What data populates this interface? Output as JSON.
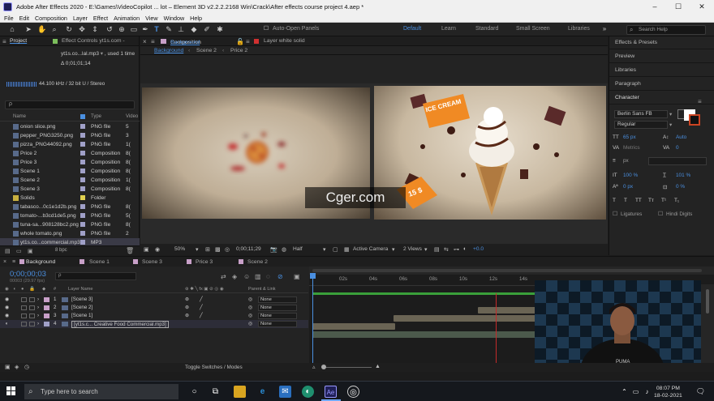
{
  "window": {
    "title": "Adobe After Effects 2020 - E:\\Games\\VideoCopilot ... lot – Element 3D v2.2.2.2168 Win\\Crack\\After effects course project 4.aep *",
    "controls": [
      "–",
      "☐",
      "✕"
    ]
  },
  "menu": [
    "File",
    "Edit",
    "Composition",
    "Layer",
    "Effect",
    "Animation",
    "View",
    "Window",
    "Help"
  ],
  "toolbar": {
    "auto_open_panels": "Auto-Open Panels",
    "workspaces": [
      "Default",
      "Learn",
      "Standard",
      "Small Screen",
      "Libraries"
    ],
    "active_workspace": "Default",
    "search_placeholder": "Search Help"
  },
  "project": {
    "tab_project": "Project",
    "tab_effect_controls": "Effect Controls yt1s.com -",
    "selected_file": "yt1s.co...lal.mp3",
    "used": ", used 1 time",
    "duration": "Δ 0;01;01;14",
    "audio_info": "44.100 kHz / 32 bit U / Stereo",
    "columns": [
      "Name",
      "Type",
      "Video"
    ],
    "items": [
      {
        "name": "onion slice.png",
        "type": "PNG file",
        "v": "5",
        "color": "#a0a0c8",
        "icon": "image-file-icon"
      },
      {
        "name": "pepper_PNG3250.png",
        "type": "PNG file",
        "v": "3",
        "color": "#a0a0c8",
        "icon": "image-file-icon"
      },
      {
        "name": "pizza_PNG44092.png",
        "type": "PNG file",
        "v": "1(",
        "color": "#a0a0c8",
        "icon": "image-file-icon"
      },
      {
        "name": "Price 2",
        "type": "Composition",
        "v": "8(",
        "color": "#a0a0c8",
        "icon": "composition-icon"
      },
      {
        "name": "Price 3",
        "type": "Composition",
        "v": "8(",
        "color": "#a0a0c8",
        "icon": "composition-icon"
      },
      {
        "name": "Scene 1",
        "type": "Composition",
        "v": "8(",
        "color": "#a0a0c8",
        "icon": "composition-icon"
      },
      {
        "name": "Scene 2",
        "type": "Composition",
        "v": "1(",
        "color": "#a0a0c8",
        "icon": "composition-icon"
      },
      {
        "name": "Scene 3",
        "type": "Composition",
        "v": "8(",
        "color": "#a0a0c8",
        "icon": "composition-icon"
      },
      {
        "name": "Solids",
        "type": "Folder",
        "v": "",
        "color": "#e0d050",
        "icon": "folder-icon"
      },
      {
        "name": "tabasco...0c1e1d2b.png",
        "type": "PNG file",
        "v": "8(",
        "color": "#a0a0c8",
        "icon": "image-file-icon"
      },
      {
        "name": "tomato-...b3cd1de5.png",
        "type": "PNG file",
        "v": "5(",
        "color": "#a0a0c8",
        "icon": "image-file-icon"
      },
      {
        "name": "tuna-sa...908128bc2.png",
        "type": "PNG file",
        "v": "8(",
        "color": "#a0a0c8",
        "icon": "image-file-icon"
      },
      {
        "name": "whole tomato.png",
        "type": "PNG file",
        "v": "2",
        "color": "#a0a0c8",
        "icon": "image-file-icon"
      },
      {
        "name": "yt1s.co...commercial.mp3",
        "type": "MP3",
        "v": "",
        "color": "#a0a0c8",
        "icon": "audio-file-icon",
        "selected": true
      }
    ],
    "bpc": "8 bpc"
  },
  "composition": {
    "tab": "Composition",
    "tab_comp_name": "Background",
    "layer_tab": "Layer  white solid",
    "breadcrumbs": [
      "Background",
      "Scene 2",
      "Price 2"
    ],
    "zoom": "50%",
    "timecode": "0;00;11;29",
    "resolution": "Half",
    "camera": "Active Camera",
    "views": "2 Views",
    "exposure": "+0.0",
    "ice_cream_label": "ICE CREAM",
    "price_label": "15 $",
    "watermark": "Cger.com"
  },
  "right_panels": {
    "sections": [
      "Effects & Presets",
      "Preview",
      "Libraries",
      "Paragraph",
      "Character"
    ],
    "font": "Berlin Sans FB",
    "style": "Regular",
    "font_size": "65 px",
    "leading": "Auto",
    "tracking_label": "Metrics",
    "tracking_value": "0",
    "stroke_unit": "px",
    "v_scale": "100 %",
    "h_scale": "101 %",
    "baseline": "0 px",
    "tsume": "0 %",
    "ligatures": "Ligatures",
    "hindi_digits": "Hindi Digits",
    "fill_color": "#ffffff"
  },
  "timeline": {
    "tabs": [
      "Background",
      "Scene 1",
      "Scene 3",
      "Price 3",
      "Scene 2"
    ],
    "timecode": "0;00;00;03",
    "timecode_sub": "00003 (29.97 fps)",
    "search_placeholder": "ρ",
    "header": {
      "num": "#",
      "layer_name": "Layer Name",
      "parent": "Parent & Link"
    },
    "layers": [
      {
        "num": "1",
        "name": "[Scene 3]",
        "parent": "None"
      },
      {
        "num": "2",
        "name": "[Scene 2]",
        "parent": "None"
      },
      {
        "num": "3",
        "name": "[Scene 1]",
        "parent": "None"
      },
      {
        "num": "4",
        "name": "[yt1s.c... Creative Food Commercial.mp3]",
        "parent": "None",
        "selected": true
      }
    ],
    "ruler": [
      "0s",
      "02s",
      "04s",
      "06s",
      "08s",
      "10s",
      "12s",
      "14s"
    ],
    "toggle": "Toggle Switches / Modes"
  },
  "taskbar": {
    "search": "Type here to search",
    "time": "08:07 PM",
    "date": "18-02-2021"
  }
}
